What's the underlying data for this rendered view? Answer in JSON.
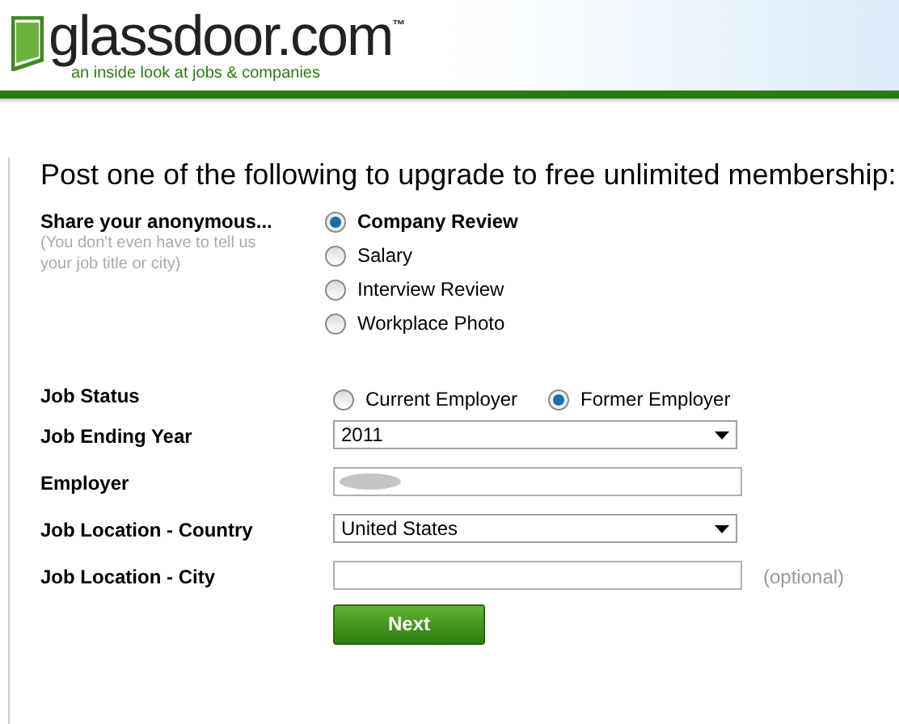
{
  "header": {
    "logo_text": "glassdoor.com",
    "trademark": "™",
    "tagline": "an inside look at jobs & companies"
  },
  "form": {
    "heading": "Post one of the following to upgrade to free unlimited membership:",
    "share": {
      "label": "Share your anonymous...",
      "hint": "(You don't even have to tell us your job title or city)",
      "options": [
        {
          "label": "Company Review",
          "selected": true
        },
        {
          "label": "Salary",
          "selected": false
        },
        {
          "label": "Interview Review",
          "selected": false
        },
        {
          "label": "Workplace Photo",
          "selected": false
        }
      ]
    },
    "job_status": {
      "label": "Job Status",
      "options": [
        {
          "label": "Current Employer",
          "selected": false
        },
        {
          "label": "Former Employer",
          "selected": true
        }
      ]
    },
    "fields": [
      {
        "kind": "select",
        "label": "Job Ending Year",
        "value": "2011"
      },
      {
        "kind": "redacted",
        "label": "Employer"
      },
      {
        "kind": "select",
        "label": "Job Location - Country",
        "value": "United States"
      },
      {
        "kind": "text",
        "label": "Job Location - City",
        "note": "(optional)"
      }
    ],
    "submit": "Next"
  }
}
